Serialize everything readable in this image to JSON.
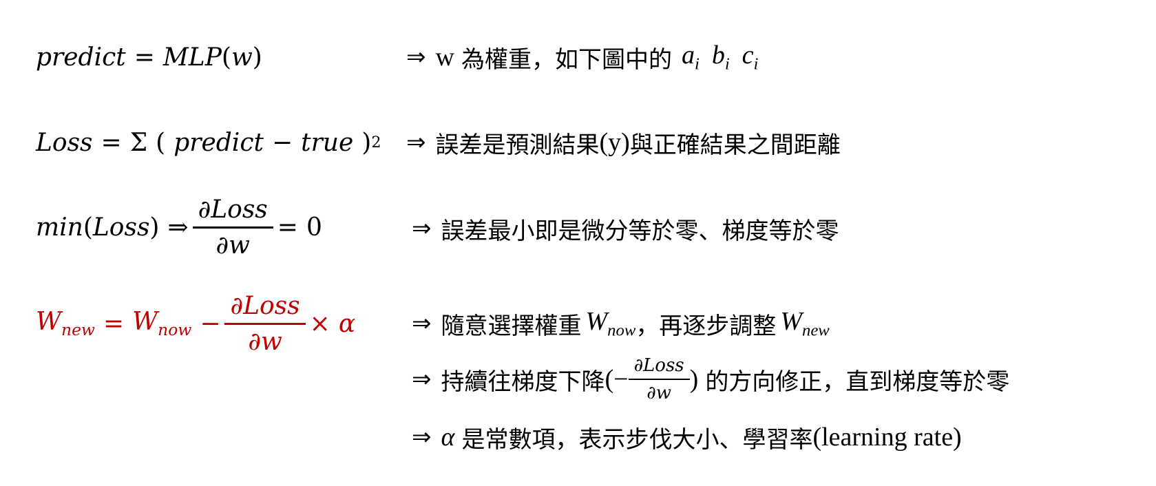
{
  "lines": [
    {
      "formula": {
        "lhs": "predict",
        "eq": "=",
        "rhs_func": "MLP",
        "rhs_arg": "w"
      },
      "note": {
        "arrow": "⇒",
        "text_w": "w",
        "text": "為權重，如下圖中的",
        "vars": [
          "a",
          "b",
          "c"
        ],
        "sub": "i"
      }
    },
    {
      "formula": {
        "lhs": "Loss",
        "eq": "=",
        "sigma": "Σ",
        "open": "(",
        "a": "predict",
        "minus": "−",
        "b": "true",
        "close": ")",
        "exp": "2"
      },
      "note": {
        "arrow": "⇒",
        "text_a": "誤差是預測結果",
        "text_y": "(y)",
        "text_b": "與正確結果之間距離"
      }
    },
    {
      "formula": {
        "func": "min",
        "arg": "Loss",
        "arrow": "⇒",
        "num": "∂Loss",
        "den": "∂w",
        "eq": "=",
        "zero": "0"
      },
      "note": {
        "arrow": "⇒",
        "text": "誤差最小即是微分等於零、梯度等於零"
      }
    },
    {
      "formula": {
        "W": "W",
        "sub_new": "new",
        "eq": "=",
        "sub_now": "now",
        "minus": "−",
        "num": "∂Loss",
        "den": "∂w",
        "times": "×",
        "alpha": "α",
        "color": "#c00000"
      },
      "note": {
        "arrow": "⇒",
        "text_a": "隨意選擇權重",
        "W": "W",
        "sub_now": "now",
        "text_b": "，再逐步調整",
        "sub_new": "new"
      }
    },
    {
      "note": {
        "arrow": "⇒",
        "text_a": "持續往梯度下降",
        "open": "(−",
        "num": "∂Loss",
        "den": "∂w",
        "close": ")",
        "text_b": "的方向修正，直到梯度等於零"
      }
    },
    {
      "note": {
        "arrow": "⇒",
        "alpha": "α",
        "text_a": "是常數項，表示步伐大小、學習率",
        "text_b": "(learning rate)"
      }
    }
  ]
}
